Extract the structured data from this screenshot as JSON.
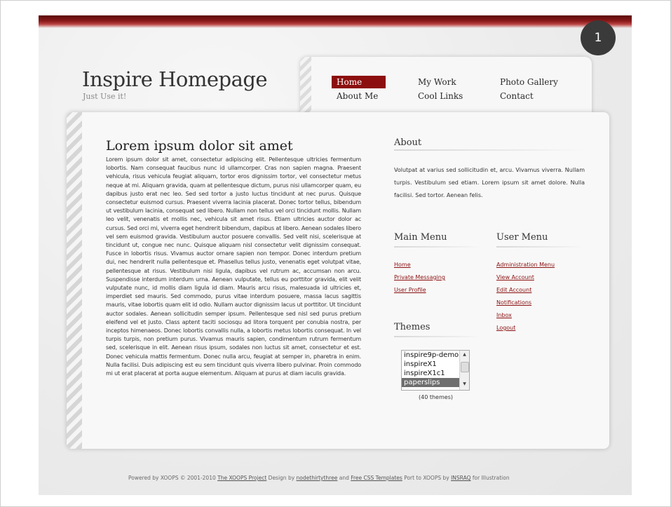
{
  "badge": "1",
  "site": {
    "title": "Inspire Homepage",
    "slogan": "Just Use it!"
  },
  "nav": {
    "home": "Home",
    "my_work": "My Work",
    "photo_gallery": "Photo Gallery",
    "about_me": "About Me",
    "cool_links": "Cool Links",
    "contact": "Contact"
  },
  "main": {
    "title": "Lorem ipsum dolor sit amet",
    "body": "Lorem ipsum dolor sit amet, consectetur adipiscing elit. Pellentesque ultricies fermentum lobortis. Nam consequat faucibus nunc id ullamcorper. Cras non sapien magna. Praesent vehicula, risus vehicula feugiat aliquam, tortor eros dignissim tortor, vel consectetur metus neque at mi. Aliquam gravida, quam at pellentesque dictum, purus nisi ullamcorper quam, eu dapibus justo erat nec leo. Sed sed tortor a justo luctus tincidunt at nec purus. Quisque consectetur euismod cursus. Praesent viverra lacinia placerat. Donec tortor tellus, bibendum ut vestibulum lacinia, consequat sed libero. Nullam non tellus vel orci tincidunt mollis. Nullam leo velit, venenatis et mollis nec, vehicula sit amet risus. Etiam ultricies auctor dolor ac cursus. Sed orci mi, viverra eget hendrerit bibendum, dapibus at libero. Aenean sodales libero vel sem euismod gravida. Vestibulum auctor posuere convallis. Sed velit nisi, scelerisque at tincidunt ut, congue nec nunc. Quisque aliquam nisl consectetur velit dignissim consequat. Fusce in lobortis risus. Vivamus auctor ornare sapien non tempor. Donec interdum pretium dui, nec hendrerit nulla pellentesque et. Phasellus tellus justo, venenatis eget volutpat vitae, pellentesque at risus. Vestibulum nisi ligula, dapibus vel rutrum ac, accumsan non arcu. Suspendisse interdum interdum urna. Aenean vulputate, tellus eu porttitor gravida, elit velit vulputate nunc, id mollis diam ligula id diam. Mauris arcu risus, malesuada id ultricies et, imperdiet sed mauris. Sed commodo, purus vitae interdum posuere, massa lacus sagittis mauris, vitae lobortis quam elit id odio. Nullam auctor dignissim lacus ut porttitor. Ut tincidunt auctor sodales. Aenean sollicitudin semper ipsum. Pellentesque sed nisl sed purus pretium eleifend vel et justo. Class aptent taciti sociosqu ad litora torquent per conubia nostra, per inceptos himenaeos. Donec lobortis convallis nulla, a lobortis metus lobortis consequat. In vel turpis turpis, non pretium purus. Vivamus mauris sapien, condimentum rutrum fermentum sed, scelerisque in elit. Aenean risus ipsum, sodales non luctus sit amet, consectetur et est. Donec vehicula mattis fermentum. Donec nulla arcu, feugiat at semper in, pharetra in enim. Nulla facilisi. Duis adipiscing est eu sem tincidunt quis viverra libero pulvinar. Proin commodo mi ut erat placerat at porta augue elementum. Aliquam at purus at diam iaculis gravida."
  },
  "about": {
    "title": "About",
    "text": "Volutpat at varius sed sollicitudin et, arcu. Vivamus viverra. Nullam turpis. Vestibulum sed etiam. Lorem ipsum sit amet dolore. Nulla facilisi. Sed tortor. Aenean felis."
  },
  "main_menu": {
    "title": "Main Menu",
    "items": [
      "Home",
      "Private Messaging",
      "User Profile"
    ]
  },
  "user_menu": {
    "title": "User Menu",
    "items": [
      "Administration Menu",
      "View Account",
      "Edit Account",
      "Notifications",
      "Inbox",
      "Logout"
    ]
  },
  "themes": {
    "title": "Themes",
    "options": [
      "inspire9p-demo",
      "inspireX1",
      "inspireX1c1",
      "paperslips"
    ],
    "selected": "paperslips",
    "count": "(40 themes)"
  },
  "footer": {
    "t1": "Powered by XOOPS © 2001-2010 ",
    "l1": "The XOOPS Project",
    "t2": " Design by ",
    "l2": "nodethirtythree",
    "t3": " and ",
    "l3": "Free CSS Templates",
    "t4": " Port to XOOPS by ",
    "l4": "INSRAQ",
    "t5": " for Illustration"
  },
  "colors": {
    "accent": "#8c0e0e",
    "link": "#8b1010",
    "header_band": "#8a1a1a"
  }
}
